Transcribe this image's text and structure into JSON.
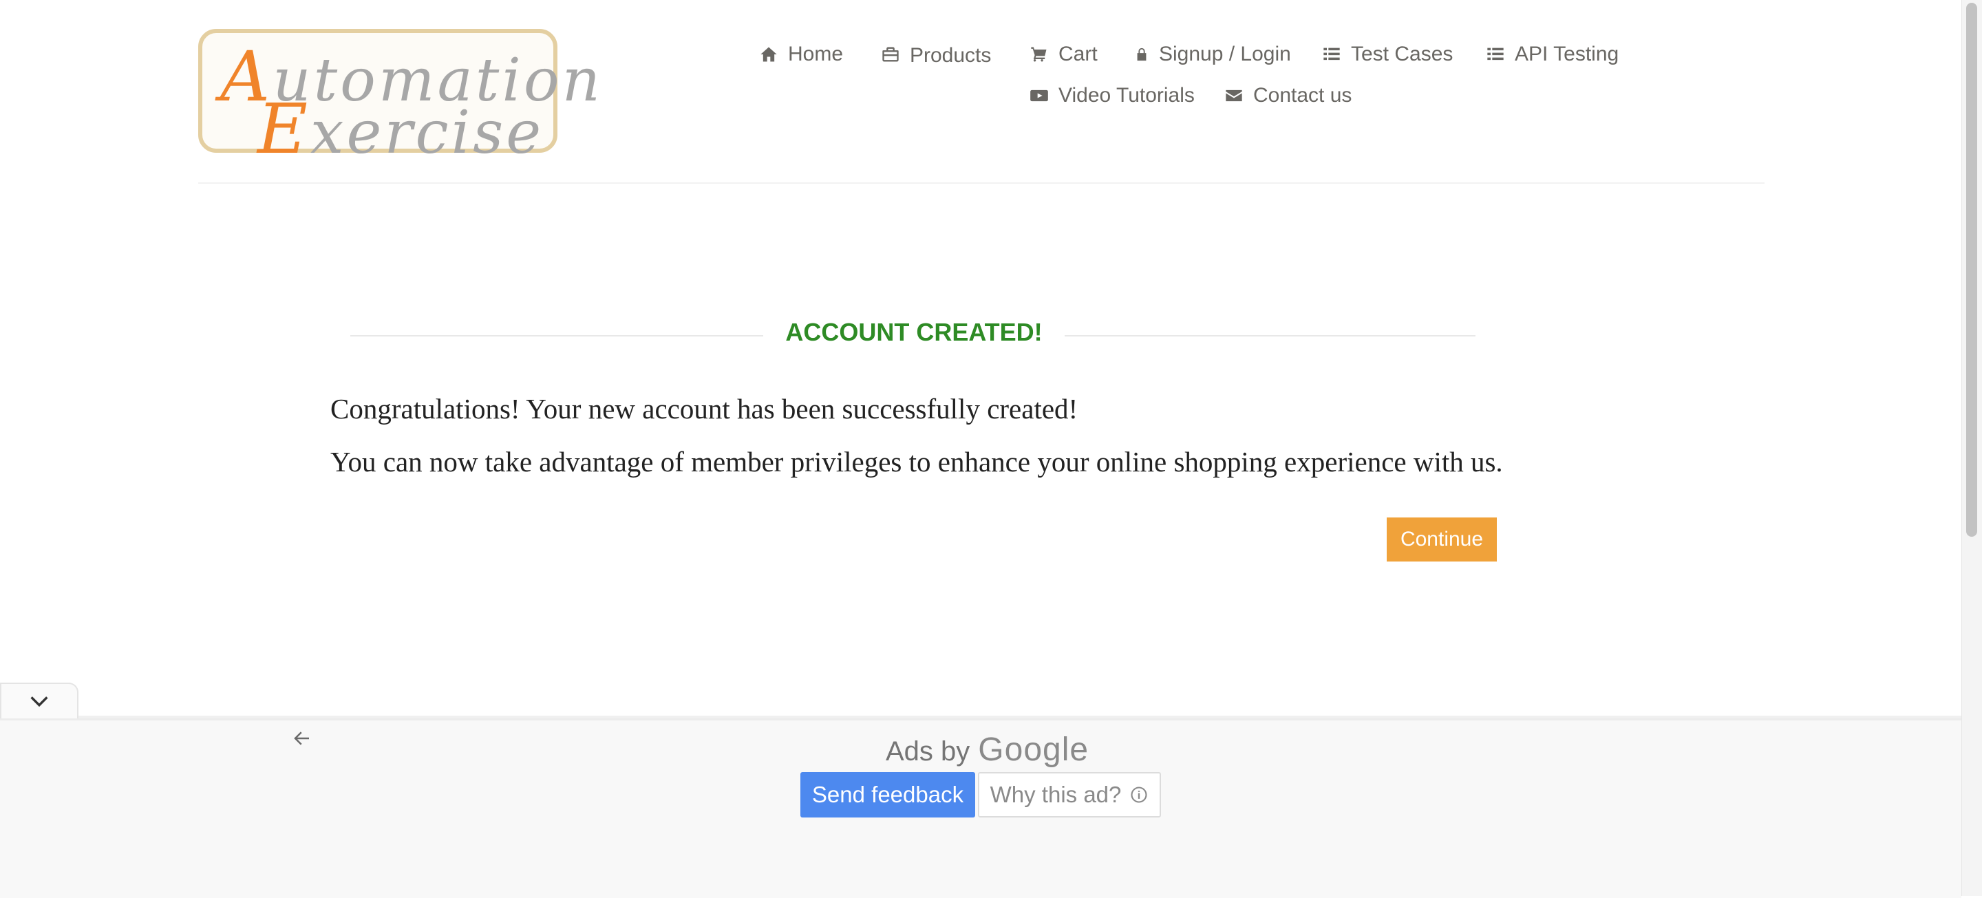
{
  "logo": {
    "line1_cap": "A",
    "line1_rest": "utomation",
    "line2_cap": "E",
    "line2_rest": "xercise"
  },
  "nav": {
    "home": "Home",
    "products": "Products",
    "cart": "Cart",
    "signup_login": "Signup / Login",
    "test_cases": "Test Cases",
    "api_testing": "API Testing",
    "video_tutorials": "Video Tutorials",
    "contact_us": "Contact us"
  },
  "main": {
    "title": "ACCOUNT CREATED!",
    "message1": "Congratulations! Your new account has been successfully created!",
    "message2": "You can now take advantage of member privileges to enhance your online shopping experience with us.",
    "continue_label": "Continue"
  },
  "ad": {
    "ads_by": "Ads by",
    "google": "Google",
    "send_feedback": "Send feedback",
    "why_this_ad": "Why this ad?"
  },
  "colors": {
    "title_green": "#2e8b25",
    "continue_orange": "#f0a23a",
    "feedback_blue": "#4d89ef",
    "logo_orange": "#f0842a"
  }
}
